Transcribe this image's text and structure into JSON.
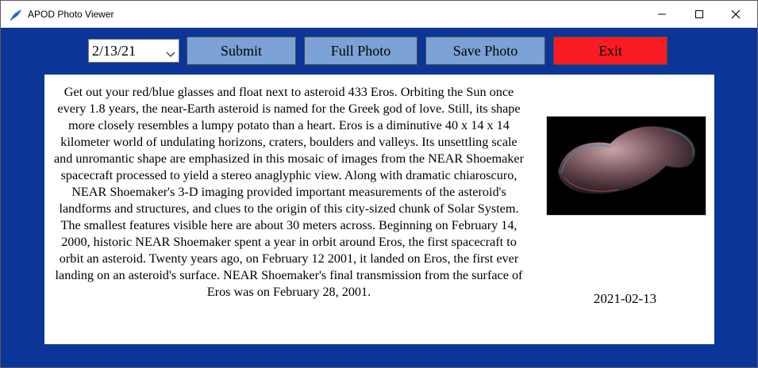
{
  "window": {
    "title": "APOD Photo Viewer"
  },
  "controls": {
    "date_value": "2/13/21",
    "submit_label": "Submit",
    "full_photo_label": "Full Photo",
    "save_photo_label": "Save Photo",
    "exit_label": "Exit"
  },
  "content": {
    "explanation": "Get out your red/blue glasses and float next to asteroid 433 Eros. Orbiting the Sun once every 1.8 years, the near-Earth asteroid is named for the Greek god of love. Still, its shape more closely resembles a lumpy potato than a heart. Eros is a diminutive 40 x 14 x 14 kilometer world of undulating horizons, craters, boulders and valleys. Its unsettling scale and unromantic shape are emphasized in this mosaic of images from the NEAR Shoemaker spacecraft processed to yield a stereo anaglyphic view.  Along with dramatic chiaroscuro, NEAR Shoemaker's 3-D imaging provided important measurements of the asteroid's landforms and structures, and clues to the origin of this city-sized chunk of Solar System. The smallest features visible here are about 30 meters across. Beginning on February 14, 2000, historic NEAR Shoemaker spent a year in orbit around Eros, the first spacecraft to orbit an asteroid. Twenty years ago, on February 12 2001, it landed on Eros, the first ever landing on an asteroid's surface. NEAR Shoemaker's final transmission from the surface of Eros was on February 28, 2001.",
    "photo_date": "2021-02-13"
  },
  "colors": {
    "background": "#0b3596",
    "button": "#7ba1d5",
    "exit_button": "#f81b24"
  }
}
